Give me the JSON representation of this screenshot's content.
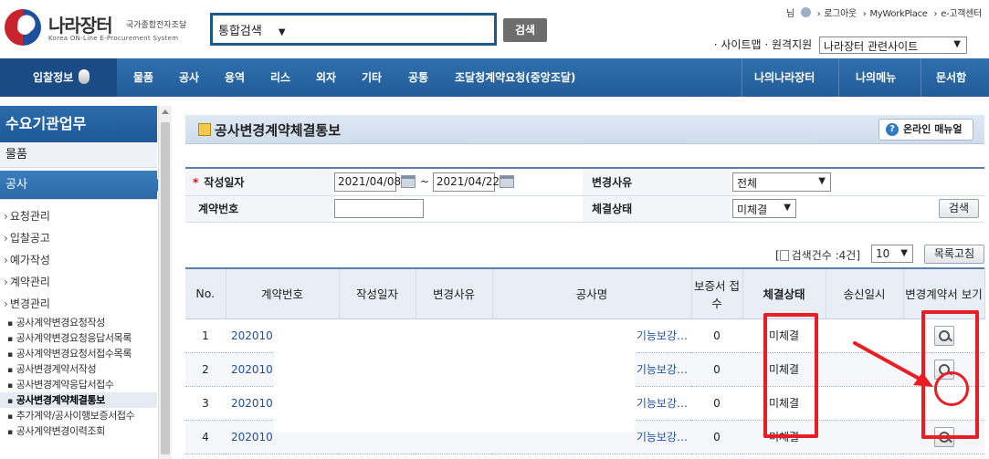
{
  "header": {
    "logo_name": "나라장터",
    "logo_sub": "국가종합전자조달",
    "logo_eng": "Korea ON-Line E-Procurement System",
    "search_scope": "통합검색",
    "search_button": "검색",
    "util_links": [
      "님",
      "로그아웃",
      "MyWorkPlace",
      "e-고객센터"
    ],
    "util_bottom": "· 사이트맵 · 원격지원",
    "related_sites": "나라장터 관련사이트"
  },
  "nav": {
    "items": [
      "입찰정보",
      "물품",
      "공사",
      "용역",
      "리스",
      "외자",
      "기타",
      "공통",
      "조달청계약요청(중앙조달)"
    ],
    "right_items": [
      "나의나라장터",
      "나의메뉴",
      "문서함"
    ]
  },
  "sidebar": {
    "title": "수요기관업무",
    "cat_goods": "물품",
    "cat_construction": "공사",
    "subs": [
      "요청관리",
      "입찰공고",
      "예가작성",
      "계약관리",
      "변경관리"
    ],
    "leaves": [
      "공사계약변경요청작성",
      "공사계약변경요청응답서목록",
      "공사계약변경요청서접수목록",
      "공사변경계약서작성",
      "공사변경계약응답서접수",
      "공사변경계약체결통보",
      "추가계약/공사이행보증서접수",
      "공사계약변경이력조회"
    ]
  },
  "page": {
    "title": "공사변경계약체결통보",
    "manual_button": "온라인 매뉴얼"
  },
  "form": {
    "date_label": "작성일자",
    "date_from": "2021/04/08",
    "date_sep": "~",
    "date_to": "2021/04/22",
    "reason_label": "변경사유",
    "reason_value": "전체",
    "contract_no_label": "계약번호",
    "contract_no_value": "",
    "status_label": "체결상태",
    "status_value": "미체결",
    "search_button": "검색"
  },
  "results": {
    "count_text": "검색건수 :4건]",
    "count_open": "[",
    "page_size": "10",
    "refresh_button": "목록고침"
  },
  "grid": {
    "headers": [
      "No.",
      "계약번호",
      "작성일자",
      "변경사유",
      "공사명",
      "보증서 접수",
      "체결상태",
      "송신일시",
      "변경계약서 보기"
    ],
    "rows": [
      {
        "no": "1",
        "contract_no": "202010",
        "name": "기능보강…",
        "guarantee": "0",
        "status": "미체결"
      },
      {
        "no": "2",
        "contract_no": "202010",
        "name": "기능보강…",
        "guarantee": "0",
        "status": "미체결"
      },
      {
        "no": "3",
        "contract_no": "202010",
        "name": "기능보강…",
        "guarantee": "0",
        "status": "미체결"
      },
      {
        "no": "4",
        "contract_no": "202010",
        "name": "기능보강…",
        "guarantee": "0",
        "status": "미체결"
      }
    ]
  },
  "colors": {
    "nav_blue": "#225c98",
    "annotation_red": "#ea1c24",
    "link_blue": "#1f4fa3"
  }
}
